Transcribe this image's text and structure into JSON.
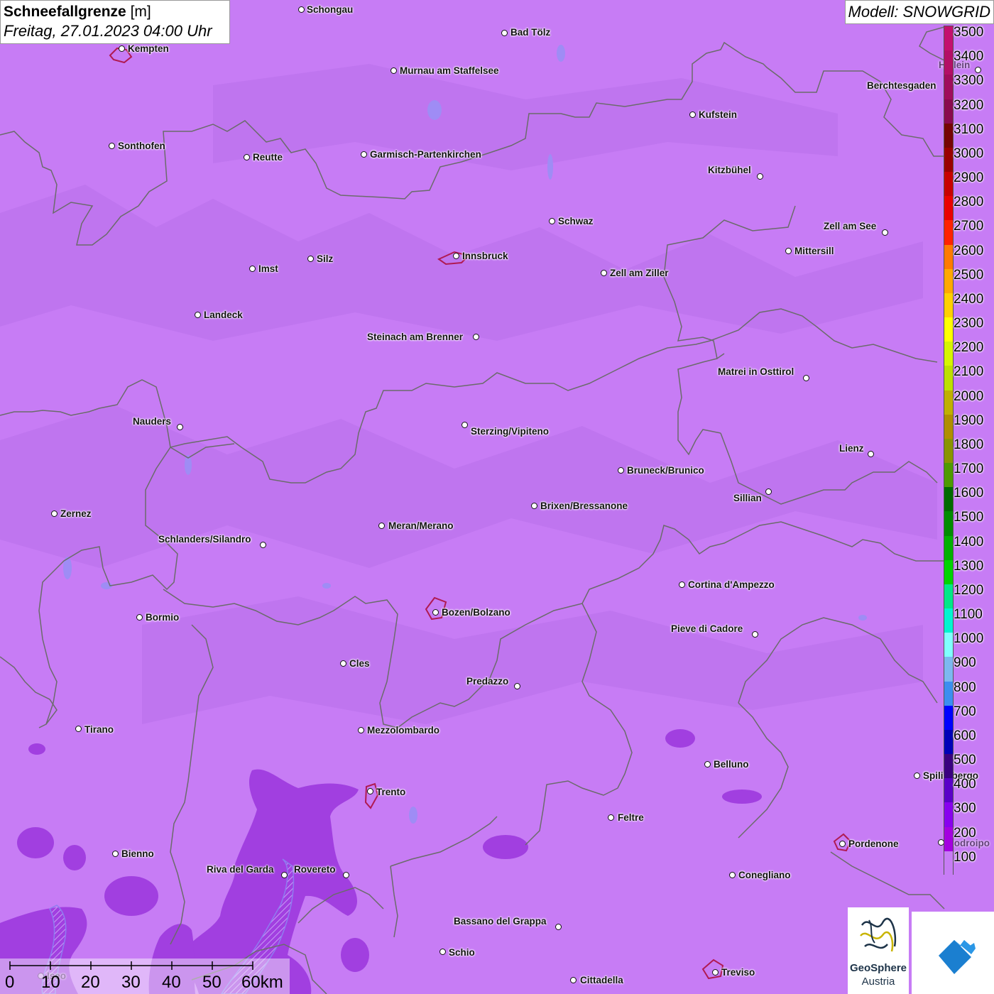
{
  "title": {
    "label": "Schneefallgrenze",
    "unit": "[m]",
    "datetime": "Freitag, 27.01.2023 04:00 Uhr"
  },
  "model": "Modell: SNOWGRID",
  "colors": {
    "background": "#c77cf5",
    "cell_darker": "#a13fe0",
    "border_line": "#6b6b6b",
    "city_outline": "#b01a52"
  },
  "legend": {
    "unit": "m",
    "stops": [
      {
        "value": "3500",
        "color": "#c4106e"
      },
      {
        "value": "3400",
        "color": "#b40e66"
      },
      {
        "value": "3300",
        "color": "#a00c5c"
      },
      {
        "value": "3200",
        "color": "#8a0a4e"
      },
      {
        "value": "3100",
        "color": "#760404"
      },
      {
        "value": "3000",
        "color": "#9a0000"
      },
      {
        "value": "2900",
        "color": "#c80000"
      },
      {
        "value": "2800",
        "color": "#ea0000"
      },
      {
        "value": "2700",
        "color": "#ff2200"
      },
      {
        "value": "2600",
        "color": "#ff7a00"
      },
      {
        "value": "2500",
        "color": "#ffa800"
      },
      {
        "value": "2400",
        "color": "#ffd000"
      },
      {
        "value": "2300",
        "color": "#ffff00"
      },
      {
        "value": "2200",
        "color": "#d6f500"
      },
      {
        "value": "2100",
        "color": "#bde000"
      },
      {
        "value": "2000",
        "color": "#c0b000"
      },
      {
        "value": "1900",
        "color": "#b08e00"
      },
      {
        "value": "1800",
        "color": "#8a9400"
      },
      {
        "value": "1700",
        "color": "#4e9a00"
      },
      {
        "value": "1600",
        "color": "#006a00"
      },
      {
        "value": "1500",
        "color": "#008c00"
      },
      {
        "value": "1400",
        "color": "#00b000"
      },
      {
        "value": "1300",
        "color": "#00d400"
      },
      {
        "value": "1200",
        "color": "#00e888"
      },
      {
        "value": "1100",
        "color": "#00f5d0"
      },
      {
        "value": "1000",
        "color": "#80ffff"
      },
      {
        "value": "900",
        "color": "#7cb8f0"
      },
      {
        "value": "800",
        "color": "#3c8ef0"
      },
      {
        "value": "700",
        "color": "#0000ff"
      },
      {
        "value": "600",
        "color": "#0000b8"
      },
      {
        "value": "500",
        "color": "#3a0080"
      },
      {
        "value": "400",
        "color": "#5a00c8"
      },
      {
        "value": "300",
        "color": "#8800ee"
      },
      {
        "value": "200",
        "color": "#a400e0"
      },
      {
        "value": "100",
        "color": "#c77cf5"
      }
    ]
  },
  "cities": [
    {
      "name": "Schongau"
    },
    {
      "name": "Bad Tölz"
    },
    {
      "name": "Kempten"
    },
    {
      "name": "Murnau am Staffelsee"
    },
    {
      "name": "Hallein"
    },
    {
      "name": "Berchtesgaden"
    },
    {
      "name": "Kufstein"
    },
    {
      "name": "Sonthofen"
    },
    {
      "name": "Reutte"
    },
    {
      "name": "Garmisch-Partenkirchen"
    },
    {
      "name": "Kitzbühel"
    },
    {
      "name": "Schwaz"
    },
    {
      "name": "Zell am See"
    },
    {
      "name": "Mittersill"
    },
    {
      "name": "Innsbruck"
    },
    {
      "name": "Imst"
    },
    {
      "name": "Silz"
    },
    {
      "name": "Zell am Ziller"
    },
    {
      "name": "Landeck"
    },
    {
      "name": "Steinach am Brenner"
    },
    {
      "name": "Matrei in Osttirol"
    },
    {
      "name": "Nauders"
    },
    {
      "name": "Sterzing/Vipiteno"
    },
    {
      "name": "Lienz"
    },
    {
      "name": "Bruneck/Brunico"
    },
    {
      "name": "Sillian"
    },
    {
      "name": "Zernez"
    },
    {
      "name": "Brixen/Bressanone"
    },
    {
      "name": "Meran/Merano"
    },
    {
      "name": "Schlanders/Silandro"
    },
    {
      "name": "Cortina d'Ampezzo"
    },
    {
      "name": "Bozen/Bolzano"
    },
    {
      "name": "Bormio"
    },
    {
      "name": "Pieve di Cadore"
    },
    {
      "name": "Cles"
    },
    {
      "name": "Predazzo"
    },
    {
      "name": "Tirano"
    },
    {
      "name": "Mezzolombardo"
    },
    {
      "name": "Belluno"
    },
    {
      "name": "Spilimbergo"
    },
    {
      "name": "Trento"
    },
    {
      "name": "Feltre"
    },
    {
      "name": "Pordenone"
    },
    {
      "name": "Codroipo"
    },
    {
      "name": "Bienno"
    },
    {
      "name": "Riva del Garda"
    },
    {
      "name": "Rovereto"
    },
    {
      "name": "Conegliano"
    },
    {
      "name": "Bassano del Grappa"
    },
    {
      "name": "Schio"
    },
    {
      "name": "Treviso"
    },
    {
      "name": "Cittadella"
    },
    {
      "name": "Iseo"
    }
  ],
  "scale": {
    "ticks": [
      "0",
      "10",
      "20",
      "30",
      "40",
      "50",
      "60km"
    ]
  },
  "logo": {
    "line1": "GeoSphere",
    "line2": "Austria"
  }
}
